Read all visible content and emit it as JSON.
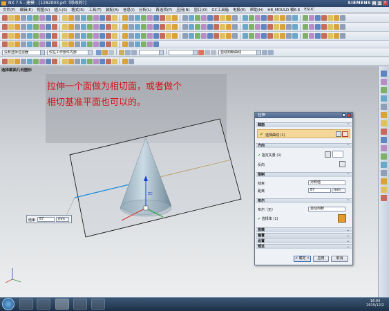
{
  "window": {
    "title": "NX 7.5 - 建模 - [1282003.prt（修改的）]",
    "brand": "SIEMENS",
    "min": "_",
    "max": "□",
    "close": "×"
  },
  "menubar": [
    "文件(F)",
    "编辑(E)",
    "视图(V)",
    "插入(S)",
    "格式(R)",
    "工具(T)",
    "装配(A)",
    "信息(I)",
    "分析(L)",
    "首选项(P)",
    "应用(N)",
    "窗口(O)",
    "GC工具箱",
    "电极(E)",
    "帮助(H)",
    "HB_MOULD 模6.6",
    "ESUC"
  ],
  "filterbar": {
    "selection_filter": "没有选择过滤器",
    "scope": "仅在工作部件内部",
    "curve_rule": "自动判断曲线"
  },
  "view_title": "选择截面几何图形",
  "note": {
    "line1": "拉伸一个面做为相切面，或者做个",
    "line2": "相切基准平面也可以的。"
  },
  "float_input": {
    "label": "结束",
    "value": "87",
    "unit": "mm"
  },
  "dialog": {
    "title": "拉伸",
    "section_section": "截面",
    "select_curve": "选择曲线 (1)",
    "section_direction": "方向",
    "specify_vector": "指定矢量 (1)",
    "reverse": "反向",
    "section_limits": "限制",
    "end_label": "结束",
    "end_value": "对称值",
    "distance_label": "距离",
    "distance_value": "87",
    "distance_unit": "mm",
    "section_boolean": "布尔",
    "boolean_label": "布尔（无）",
    "boolean_value": "自动判断",
    "select_body": "选择体 (1)",
    "section_draft": "拔模",
    "section_offset": "偏置",
    "section_settings": "设置",
    "section_preview": "预览",
    "ok": "< 确定 >",
    "apply": "应用",
    "cancel": "取消"
  },
  "axes": {
    "zc": "ZC",
    "yc": "YC",
    "xc": "XC"
  },
  "clock": {
    "time": "16:04",
    "date": "2015/12/2"
  }
}
